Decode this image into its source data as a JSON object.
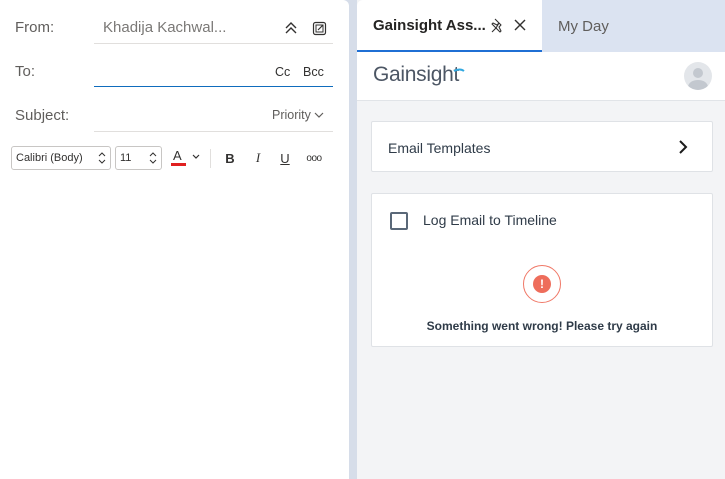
{
  "compose": {
    "from_label": "From:",
    "from_value": "Khadija Kachwal...",
    "to_label": "To:",
    "cc_label": "Cc",
    "bcc_label": "Bcc",
    "subject_label": "Subject:",
    "priority_label": "Priority",
    "toolbar": {
      "font_name": "Calibri (Body)",
      "font_size": "11",
      "font_color": "#e02020",
      "bold": "B",
      "italic": "I",
      "underline": "U",
      "more": "ooo"
    }
  },
  "addin": {
    "tabs": [
      {
        "label": "Gainsight Ass...",
        "active": true
      },
      {
        "label": "My Day",
        "active": false
      }
    ],
    "logo_text": "Gainsight",
    "templates_label": "Email Templates",
    "log_label": "Log Email to Timeline",
    "log_checked": false,
    "error_message": "Something went wrong! Please try again",
    "colors": {
      "accent": "#1f6fd4",
      "error": "#ee6d5b",
      "logo_accent": "#31a8e0"
    }
  }
}
